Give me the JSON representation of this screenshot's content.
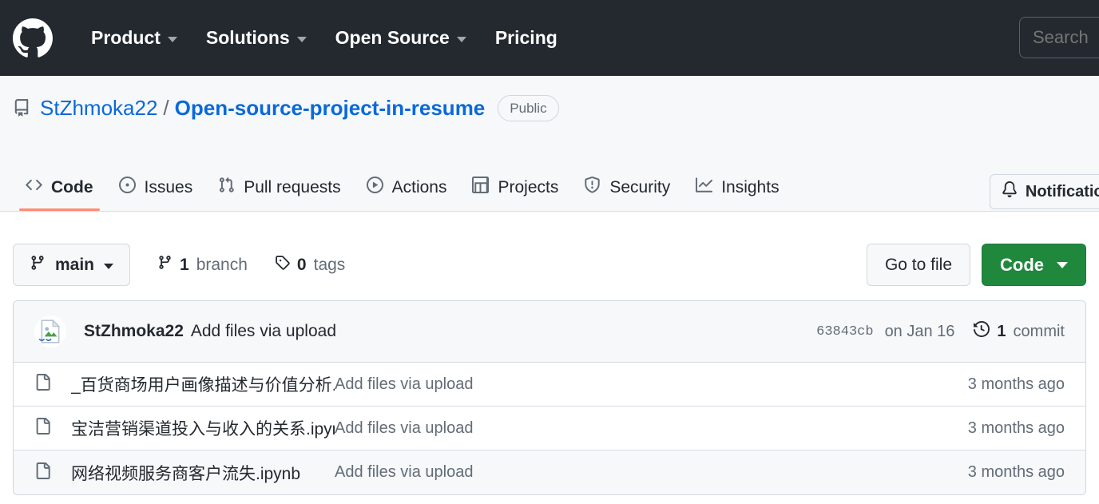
{
  "header": {
    "logo_icon": "github-mark-icon",
    "nav": [
      {
        "label": "Product",
        "has_dropdown": true
      },
      {
        "label": "Solutions",
        "has_dropdown": true
      },
      {
        "label": "Open Source",
        "has_dropdown": true
      },
      {
        "label": "Pricing",
        "has_dropdown": false
      }
    ],
    "search_placeholder": "Search",
    "search_value": "",
    "background": "#24292f"
  },
  "repo": {
    "icon": "repo-icon",
    "owner": "StZhmoka22",
    "separator": "/",
    "name": "Open-source-project-in-resume",
    "visibility": "Public",
    "notifications_label": "Notifications",
    "notifications_icon": "bell-icon",
    "tabs": [
      {
        "label": "Code",
        "icon": "code-icon",
        "active": true
      },
      {
        "label": "Issues",
        "icon": "issue-opened-icon",
        "active": false
      },
      {
        "label": "Pull requests",
        "icon": "git-pull-request-icon",
        "active": false
      },
      {
        "label": "Actions",
        "icon": "play-icon",
        "active": false
      },
      {
        "label": "Projects",
        "icon": "table-icon",
        "active": false
      },
      {
        "label": "Security",
        "icon": "shield-icon",
        "active": false
      },
      {
        "label": "Insights",
        "icon": "graph-icon",
        "active": false
      }
    ],
    "active_tab_underline_color": "#fd8c73"
  },
  "toolbar": {
    "branch_name": "main",
    "branch_icon": "git-branch-icon",
    "branch_count_value": "1",
    "branch_count_label": "branch",
    "tag_count_value": "0",
    "tag_count_label": "tags",
    "tag_icon": "tag-icon",
    "go_to_file_label": "Go to file",
    "code_label": "Code",
    "code_button_color": "#1f883d"
  },
  "commit_bar": {
    "avatar_icon": "broken-image-avatar",
    "author": "StZhmoka22",
    "message": "Add files via upload",
    "hash": "63843cb",
    "date": "on Jan 16",
    "history_icon": "history-icon",
    "commit_count_value": "1",
    "commit_count_label": "commit"
  },
  "files": {
    "icon": "file-icon",
    "rows": [
      {
        "name": "_百货商场用户画像描述与价值分析.i...",
        "commit_message": "Add files via upload",
        "age": "3 months ago",
        "hovered": false
      },
      {
        "name": "宝洁营销渠道投入与收入的关系.ipynb",
        "commit_message": "Add files via upload",
        "age": "3 months ago",
        "hovered": false
      },
      {
        "name": "网络视频服务商客户流失.ipynb",
        "commit_message": "Add files via upload",
        "age": "3 months ago",
        "hovered": true
      }
    ]
  }
}
